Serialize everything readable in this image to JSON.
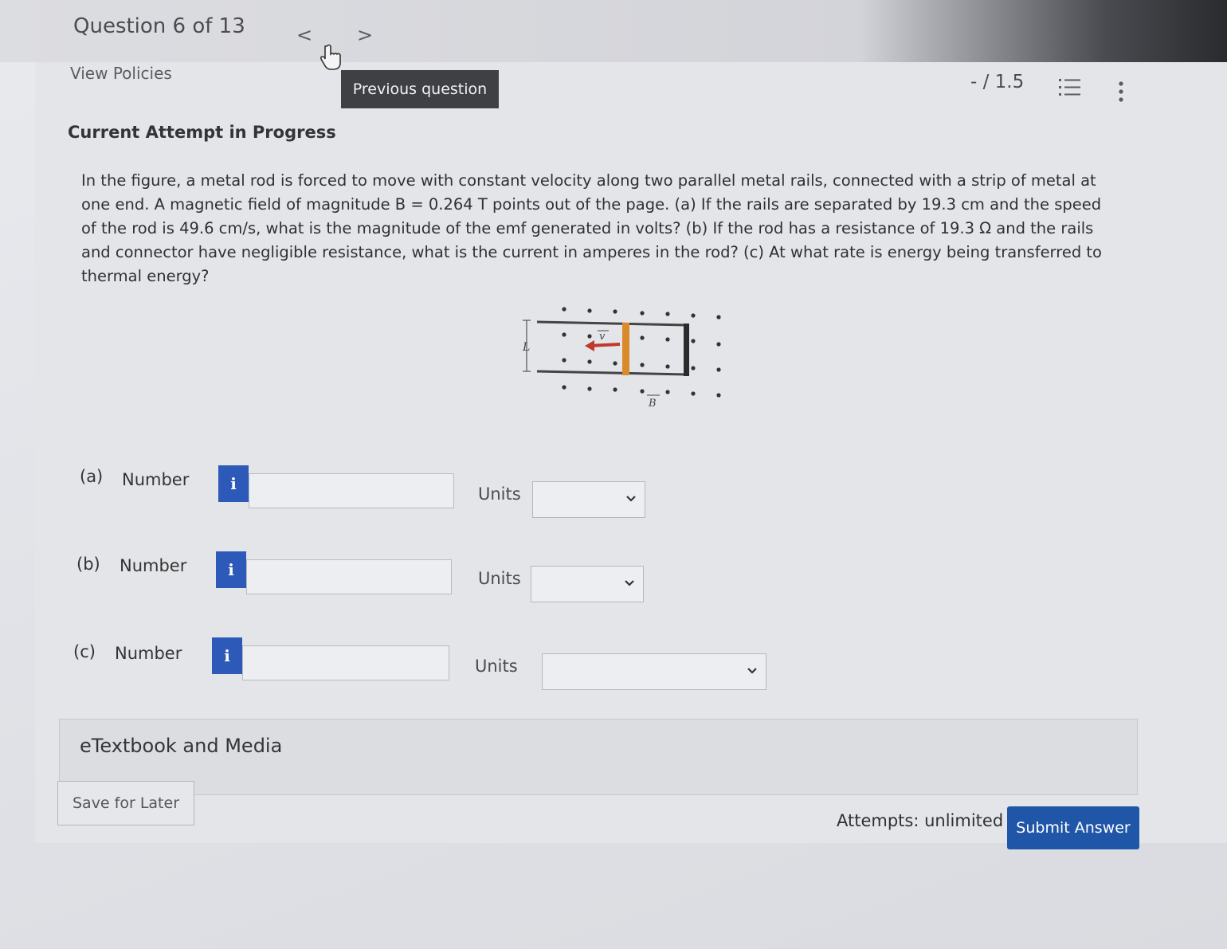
{
  "header": {
    "question_title": "Question 6 of 13",
    "prev_glyph": "<",
    "next_glyph": ">",
    "view_policies": "View Policies",
    "tooltip": "Previous question",
    "score": "- / 1.5"
  },
  "attempt_heading": "Current Attempt in Progress",
  "problem_text": "In the figure, a metal rod is forced to move with constant velocity along two parallel metal rails, connected with a strip of metal at one end. A magnetic field of magnitude B = 0.264 T points out of the page. (a) If the rails are separated by 19.3 cm and the speed of the rod is 49.6 cm/s, what is the magnitude of the emf generated in volts? (b) If the rod has a resistance of 19.3 Ω and the rails and connector have negligible resistance, what is the current in amperes in the rod? (c) At what rate is energy being transferred to thermal energy?",
  "figure": {
    "label_L": "L",
    "label_v": "v",
    "label_B": "B"
  },
  "parts": [
    {
      "label": "(a)",
      "number_label": "Number",
      "info": "i",
      "value": "",
      "units_label": "Units",
      "units_value": ""
    },
    {
      "label": "(b)",
      "number_label": "Number",
      "info": "i",
      "value": "",
      "units_label": "Units",
      "units_value": ""
    },
    {
      "label": "(c)",
      "number_label": "Number",
      "info": "i",
      "value": "",
      "units_label": "Units",
      "units_value": ""
    }
  ],
  "etextbook": "eTextbook and Media",
  "footer": {
    "save_for_later": "Save for Later",
    "attempts": "Attempts: unlimited",
    "submit": "Submit Answer"
  },
  "colors": {
    "accent": "#2d59b8",
    "submit": "#1f56a8",
    "tooltip_bg": "#3f4044",
    "rod": "#d98a2b",
    "arrow": "#c0392b"
  }
}
